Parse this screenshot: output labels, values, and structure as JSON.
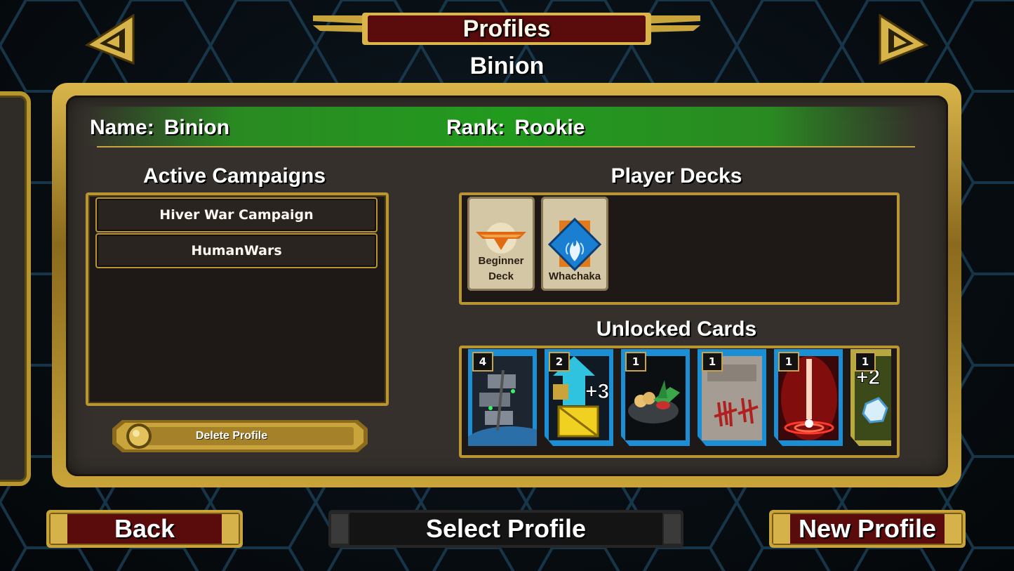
{
  "header": {
    "title": "Profiles",
    "profile_name": "Binion",
    "prev_icon": "triangle-left-icon",
    "next_icon": "triangle-right-icon"
  },
  "profile": {
    "name_label": "Name:",
    "name_value": "Binion",
    "rank_label": "Rank:",
    "rank_value": "Rookie"
  },
  "campaigns": {
    "heading": "Active Campaigns",
    "items": [
      "Hiver War Campaign",
      "HumanWars"
    ],
    "delete_label": "Delete Profile"
  },
  "decks": {
    "heading": "Player Decks",
    "items": [
      {
        "line1": "Beginner",
        "line2": "Deck",
        "icon": "winged-emblem-icon"
      },
      {
        "line1": "Whachaka",
        "line2": "",
        "icon": "blue-flame-icon"
      }
    ]
  },
  "unlocked": {
    "heading": "Unlocked Cards",
    "cards": [
      {
        "count": "4",
        "icon": "space-station-icon"
      },
      {
        "count": "2",
        "icon": "supply-crate-icon",
        "overlay": "+3"
      },
      {
        "count": "1",
        "icon": "food-bowl-icon"
      },
      {
        "count": "1",
        "icon": "tally-marks-icon"
      },
      {
        "count": "1",
        "icon": "red-beacon-icon"
      },
      {
        "count": "1",
        "icon": "dice-icon",
        "overlay": "+2"
      }
    ]
  },
  "footer": {
    "back": "Back",
    "select": "Select Profile",
    "new": "New Profile"
  },
  "colors": {
    "gold": "#c8a440",
    "panel": "#35302b",
    "green": "#229a1e",
    "button_red": "#5a0b0b",
    "card_blue": "#1b8fd6"
  }
}
